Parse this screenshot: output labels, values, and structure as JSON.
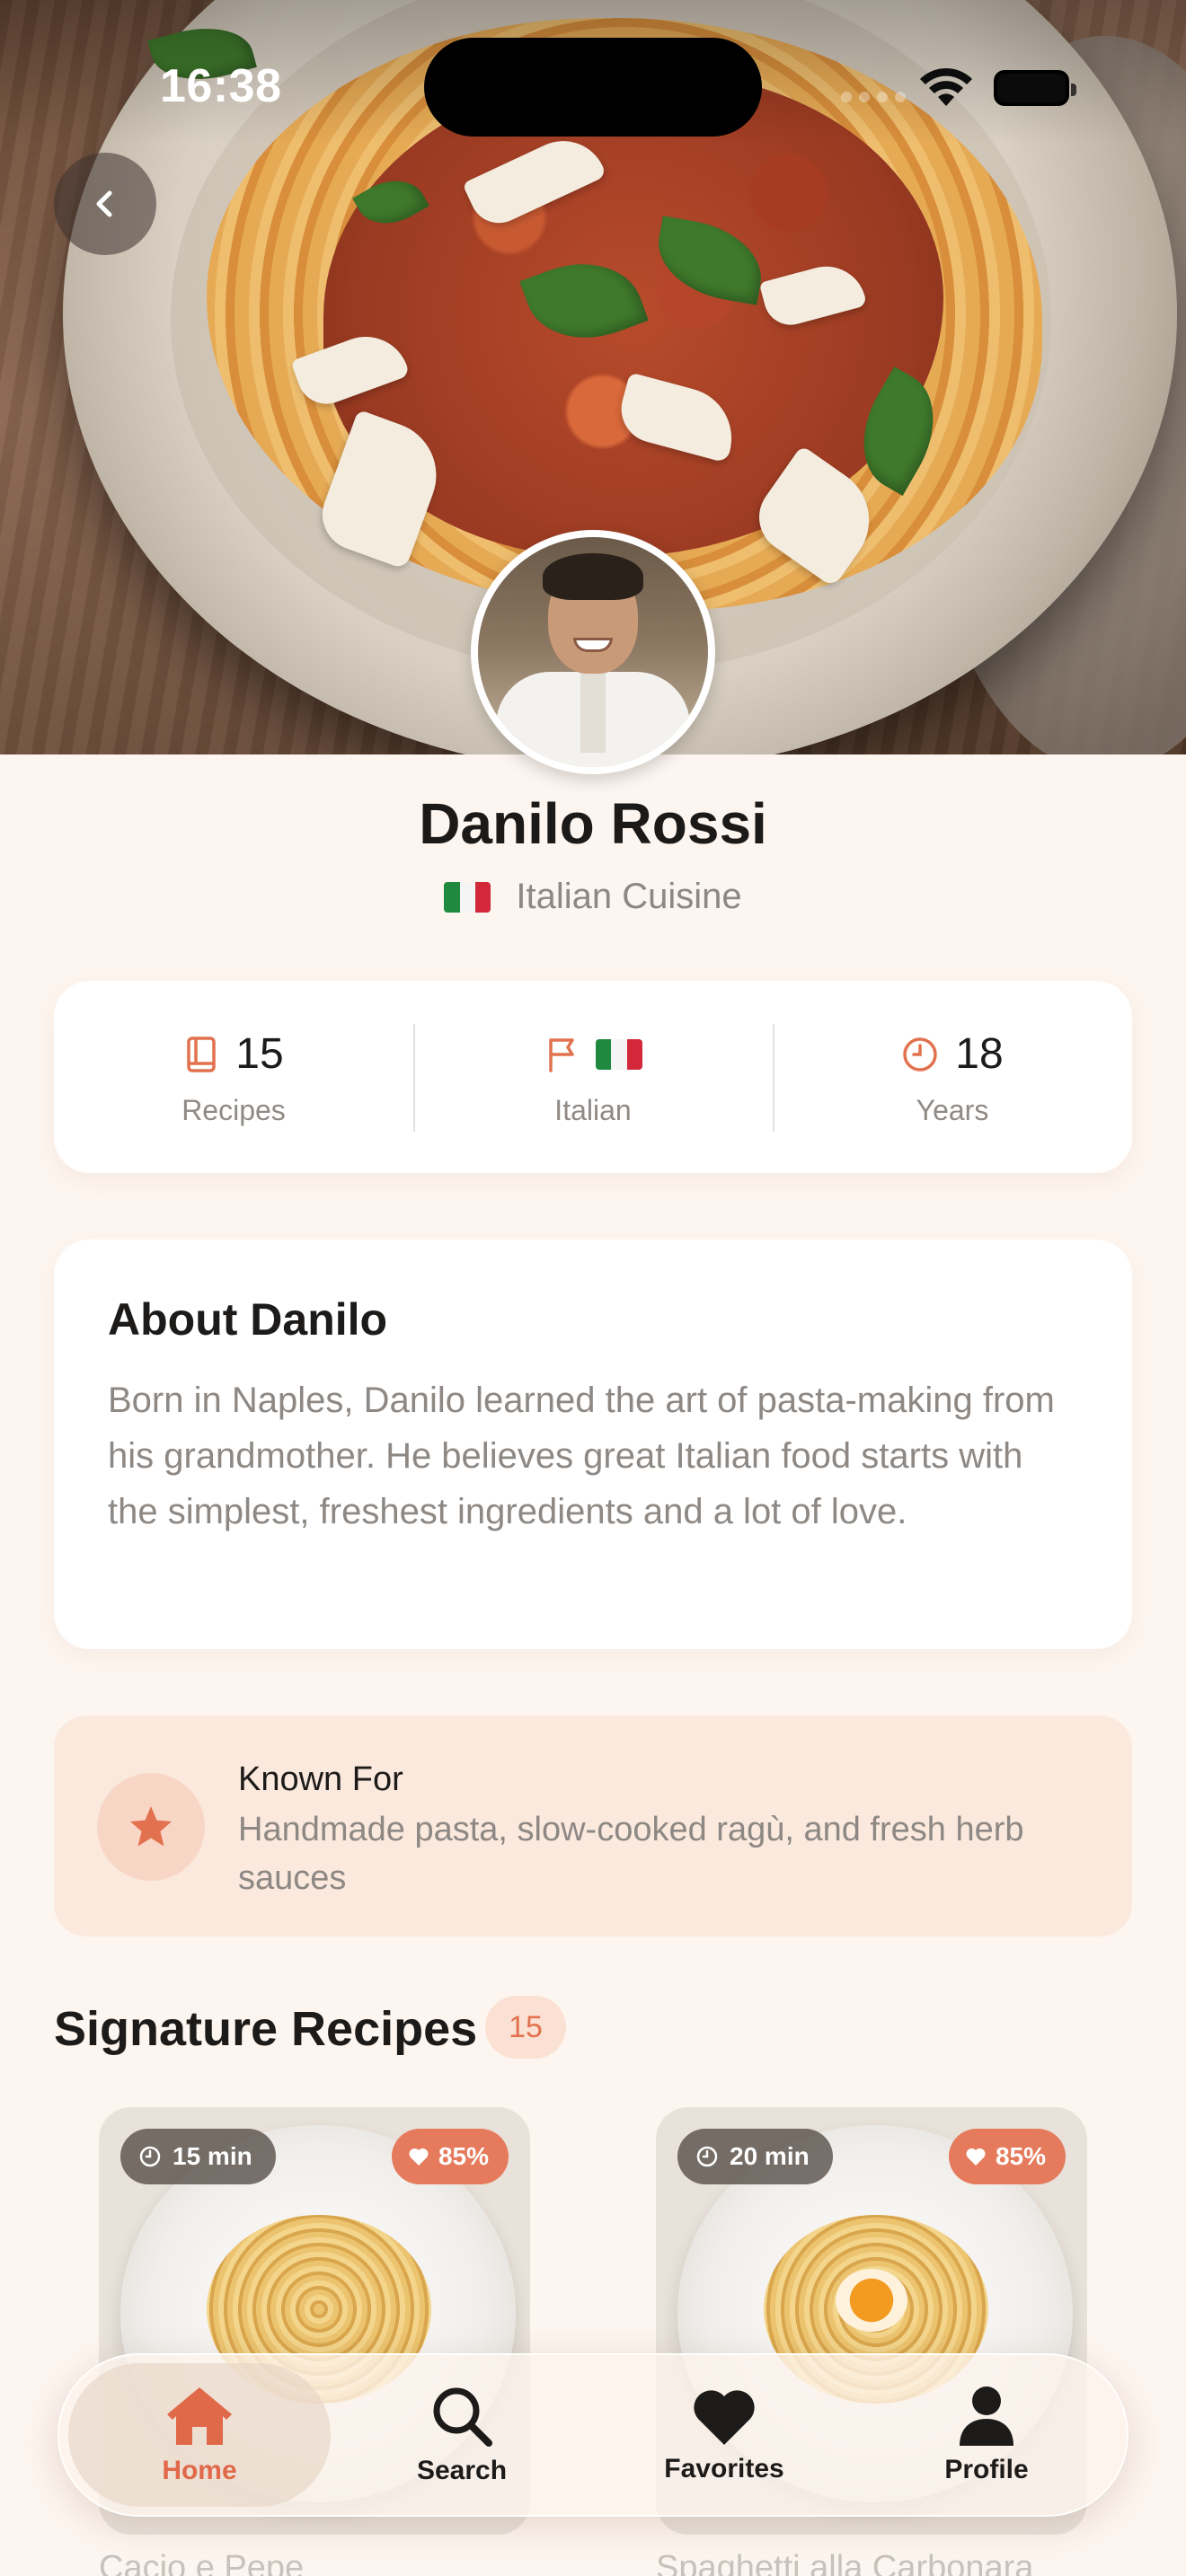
{
  "status_bar": {
    "time": "16:38"
  },
  "chef": {
    "name": "Danilo Rossi",
    "cuisine": "Italian Cuisine"
  },
  "stats": [
    {
      "value": "15",
      "label": "Recipes",
      "icon": "book-icon"
    },
    {
      "value": "",
      "label": "Italian",
      "icon": "flag-icon"
    },
    {
      "value": "18",
      "label": "Years",
      "icon": "clock-icon"
    }
  ],
  "about": {
    "title": "About Danilo",
    "body": "Born in Naples, Danilo learned the art of pasta-making from his grandmother. He believes great Italian food starts with the simplest, freshest ingredients and a lot of love."
  },
  "known_for": {
    "title": "Known For",
    "body": "Handmade pasta, slow-cooked ragù, and fresh herb sauces",
    "icon": "star-icon"
  },
  "signature": {
    "title": "Signature Recipes",
    "count": "15",
    "recipes": [
      {
        "time": "15 min",
        "rating": "85%",
        "title": "Cacio e Pepe"
      },
      {
        "time": "20 min",
        "rating": "85%",
        "title": "Spaghetti alla Carbonara"
      }
    ]
  },
  "tab_bar": {
    "tabs": [
      {
        "label": "Home",
        "icon": "home-icon",
        "active": true
      },
      {
        "label": "Search",
        "icon": "search-icon",
        "active": false
      },
      {
        "label": "Favorites",
        "icon": "heart-icon",
        "active": false
      },
      {
        "label": "Profile",
        "icon": "person-icon",
        "active": false
      }
    ]
  },
  "colors": {
    "accent": "#e2724f",
    "background": "#fdf5ef",
    "known_bg": "#fbe9de",
    "flag_green": "#1f8a3f",
    "flag_red": "#d2283a"
  }
}
